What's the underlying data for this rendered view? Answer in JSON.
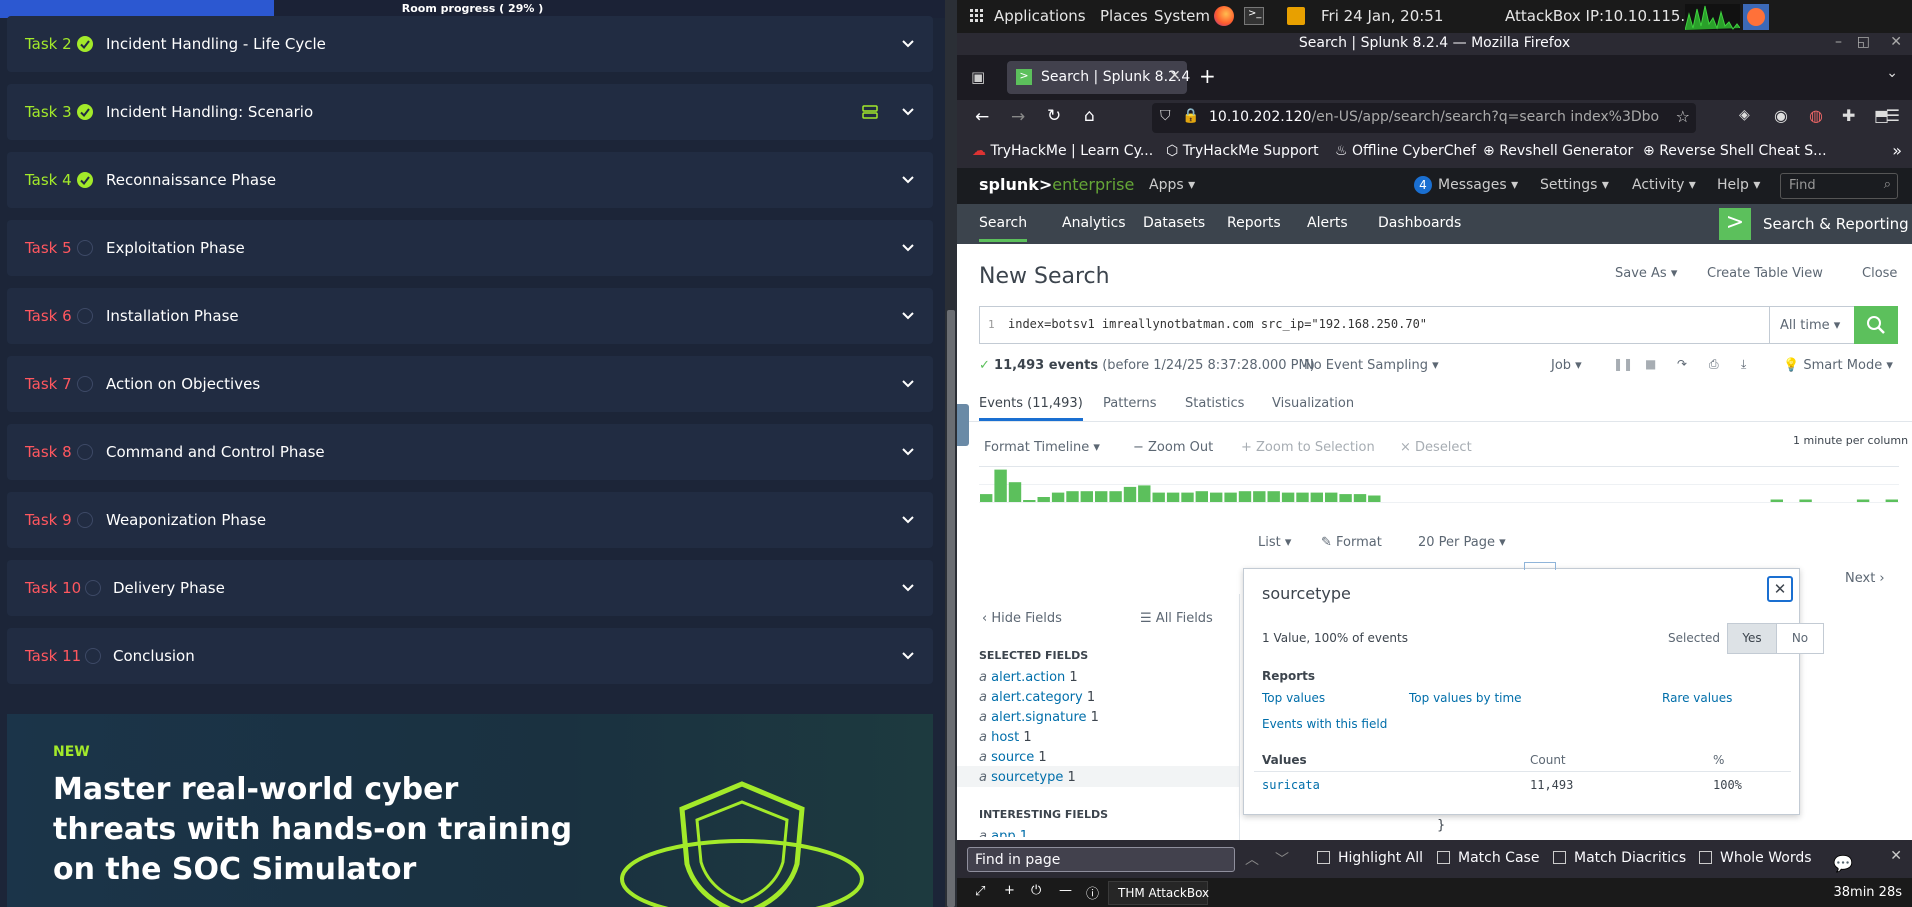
{
  "progress": {
    "label": "Room progress ( 29% )",
    "percent": 29
  },
  "tasks": [
    {
      "num": "Task 2",
      "title": "Incident Handling - Life Cycle",
      "done": true
    },
    {
      "num": "Task 3",
      "title": "Incident Handling: Scenario",
      "done": true
    },
    {
      "num": "Task 4",
      "title": "Reconnaissance Phase",
      "done": true
    },
    {
      "num": "Task 5",
      "title": "Exploitation Phase",
      "done": false
    },
    {
      "num": "Task 6",
      "title": "Installation Phase",
      "done": false
    },
    {
      "num": "Task 7",
      "title": "Action on Objectives",
      "done": false
    },
    {
      "num": "Task 8",
      "title": "Command and Control Phase",
      "done": false
    },
    {
      "num": "Task 9",
      "title": "Weaponization Phase",
      "done": false
    },
    {
      "num": "Task 10",
      "title": "Delivery Phase",
      "done": false
    },
    {
      "num": "Task 11",
      "title": "Conclusion",
      "done": false
    }
  ],
  "banner": {
    "tag": "NEW",
    "headline": "Master real-world cyber threats with hands-on training on the SOC Simulator"
  },
  "desktop": {
    "applications": "Applications",
    "places": "Places",
    "system": "System",
    "datetime": "Fri 24 Jan, 20:51",
    "attackbox_ip": "AttackBox IP:10.10.115.111"
  },
  "firefox": {
    "window_title": "Search | Splunk 8.2.4 — Mozilla Firefox",
    "tab_title": "Search | Splunk 8.2.4",
    "url_host": "10.10.202.120",
    "url_path": "/en-US/app/search/search?q=search index%3Dbo",
    "bookmarks": [
      "TryHackMe | Learn Cy...",
      "TryHackMe Support",
      "Offline CyberChef",
      "Revshell Generator",
      "Reverse Shell Cheat S..."
    ]
  },
  "splunk": {
    "logo_a": "splunk>",
    "logo_b": "enterprise",
    "apps": "Apps",
    "messages_count": "4",
    "messages": "Messages",
    "settings": "Settings",
    "activity": "Activity",
    "help": "Help",
    "find_placeholder": "Find",
    "nav": [
      "Search",
      "Analytics",
      "Datasets",
      "Reports",
      "Alerts",
      "Dashboards"
    ],
    "app_name": "Search & Reporting",
    "page_title": "New Search",
    "save_as": "Save As",
    "create_table": "Create Table View",
    "close": "Close",
    "line_no": "1",
    "query": "index=botsv1 imreallynotbatman.com src_ip=\"192.168.250.70\"",
    "time_range": "All time",
    "events_count": "11,493 events",
    "events_before": "(before 1/24/25 8:37:28.000 PM)",
    "sampling": "No Event Sampling",
    "job": "Job",
    "smart_mode": "Smart Mode",
    "result_tabs": [
      "Events (11,493)",
      "Patterns",
      "Statistics",
      "Visualization"
    ],
    "format_timeline": "Format Timeline",
    "zoom_out": "Zoom Out",
    "zoom_selection": "Zoom to Selection",
    "deselect": "Deselect",
    "per_column": "1 minute per column",
    "timeline": [
      0.22,
      0.9,
      0.55,
      0.04,
      0.14,
      0.26,
      0.3,
      0.3,
      0.3,
      0.3,
      0.42,
      0.46,
      0.26,
      0.26,
      0.26,
      0.3,
      0.26,
      0.26,
      0.3,
      0.3,
      0.3,
      0.26,
      0.26,
      0.26,
      0.26,
      0.22,
      0.22,
      0.18,
      0,
      0,
      0,
      0,
      0,
      0,
      0,
      0,
      0,
      0,
      0,
      0,
      0,
      0,
      0,
      0,
      0,
      0,
      0,
      0,
      0,
      0,
      0,
      0,
      0,
      0,
      0,
      0.07,
      0,
      0.07,
      0,
      0,
      0,
      0.07,
      0,
      0.07
    ],
    "list": "List",
    "format": "Format",
    "per_page": "20 Per Page",
    "next": "Next",
    "hide_fields": "Hide Fields",
    "all_fields": "All Fields",
    "selected_fields_header": "SELECTED FIELDS",
    "selected_fields": [
      {
        "name": "alert.action",
        "count": "1"
      },
      {
        "name": "alert.category",
        "count": "1"
      },
      {
        "name": "alert.signature",
        "count": "1"
      },
      {
        "name": "host",
        "count": "1"
      },
      {
        "name": "source",
        "count": "1"
      },
      {
        "name": "sourcetype",
        "count": "1"
      }
    ],
    "interesting_header": "INTERESTING FIELDS",
    "interesting_partial": "app  1",
    "popup": {
      "title": "sourcetype",
      "summary": "1 Value, 100% of events",
      "selected_label": "Selected",
      "yes": "Yes",
      "no": "No",
      "reports_label": "Reports",
      "top_values": "Top values",
      "top_values_time": "Top values by time",
      "rare_values": "Rare values",
      "events_with_field": "Events with this field",
      "col_values": "Values",
      "col_count": "Count",
      "col_pct": "%",
      "row_value": "suricata",
      "row_count": "11,493",
      "row_pct": "100%"
    },
    "brace": "}"
  },
  "findbar": {
    "placeholder": "Find in page",
    "highlight_all": "Highlight All",
    "match_case": "Match Case",
    "match_diacritics": "Match Diacritics",
    "whole_words": "Whole Words"
  },
  "bottombar": {
    "label": "THM AttackBox",
    "timer": "38min 28s"
  }
}
